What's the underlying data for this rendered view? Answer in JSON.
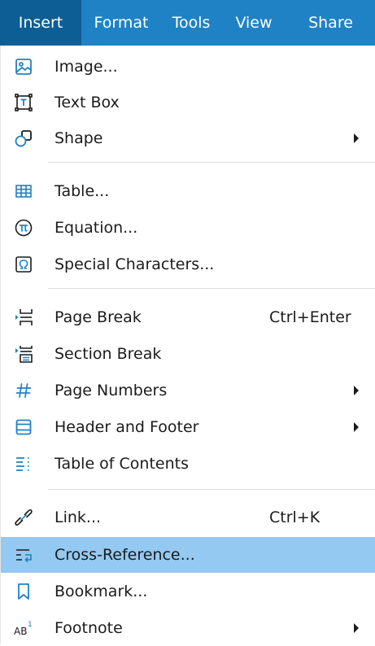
{
  "menubar": {
    "items": [
      {
        "label": "Insert",
        "active": true
      },
      {
        "label": "Format",
        "active": false
      },
      {
        "label": "Tools",
        "active": false
      },
      {
        "label": "View",
        "active": false
      },
      {
        "label": "Share",
        "active": false
      }
    ]
  },
  "menu": {
    "items": [
      {
        "label": "Image...",
        "icon": "image-icon",
        "shortcut": "",
        "submenu": false
      },
      {
        "label": "Text Box",
        "icon": "text-box-icon",
        "shortcut": "",
        "submenu": false
      },
      {
        "label": "Shape",
        "icon": "shape-icon",
        "shortcut": "",
        "submenu": true
      },
      {
        "label": "Table...",
        "icon": "table-icon",
        "shortcut": "",
        "submenu": false
      },
      {
        "label": "Equation...",
        "icon": "equation-icon",
        "shortcut": "",
        "submenu": false
      },
      {
        "label": "Special Characters...",
        "icon": "special-characters-icon",
        "shortcut": "",
        "submenu": false
      },
      {
        "label": "Page Break",
        "icon": "page-break-icon",
        "shortcut": "Ctrl+Enter",
        "submenu": false
      },
      {
        "label": "Section Break",
        "icon": "section-break-icon",
        "shortcut": "",
        "submenu": false
      },
      {
        "label": "Page Numbers",
        "icon": "page-numbers-icon",
        "shortcut": "",
        "submenu": true
      },
      {
        "label": "Header and Footer",
        "icon": "header-footer-icon",
        "shortcut": "",
        "submenu": true
      },
      {
        "label": "Table of Contents",
        "icon": "table-of-contents-icon",
        "shortcut": "",
        "submenu": false
      },
      {
        "label": "Link...",
        "icon": "link-icon",
        "shortcut": "Ctrl+K",
        "submenu": false
      },
      {
        "label": "Cross-Reference...",
        "icon": "cross-reference-icon",
        "shortcut": "",
        "submenu": false,
        "highlighted": true
      },
      {
        "label": "Bookmark...",
        "icon": "bookmark-icon",
        "shortcut": "",
        "submenu": false
      },
      {
        "label": "Footnote",
        "icon": "footnote-icon",
        "shortcut": "",
        "submenu": true
      }
    ]
  },
  "colors": {
    "menubar_bg": "#1f82c4",
    "menubar_active_bg": "#0d5e95",
    "highlight_bg": "#94c9f2",
    "icon_accent": "#1f82c4"
  }
}
